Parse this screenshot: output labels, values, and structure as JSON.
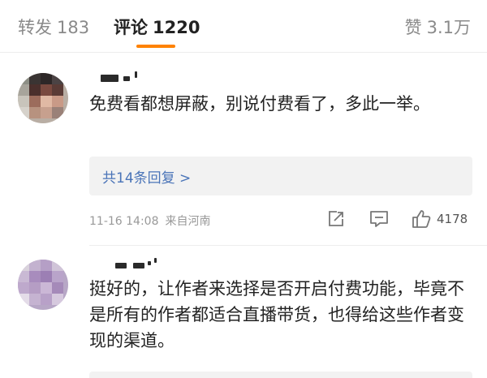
{
  "tabs": {
    "repost": {
      "label": "转发",
      "count": "183"
    },
    "comments": {
      "label": "评论",
      "count": "1220"
    },
    "likes": {
      "label": "赞",
      "count": "3.1万"
    }
  },
  "colors": {
    "accent": "#ff8200",
    "link": "#4a74b8",
    "reply_bg": "#f2f2f2"
  },
  "comments": [
    {
      "username": "",
      "text": "免费看都想屏蔽，别说付费看了，多此一举。",
      "replies_link": "共14条回复 >",
      "time": "11-16 14:08",
      "location": "来自河南",
      "like_count": "4178",
      "icons": [
        "share-icon",
        "comment-icon",
        "like-icon"
      ]
    },
    {
      "username": "",
      "text": "挺好的，让作者来选择是否开启付费功能，毕竟不是所有的作者都适合直播带货，也得给这些作者变现的渠道。"
    }
  ]
}
